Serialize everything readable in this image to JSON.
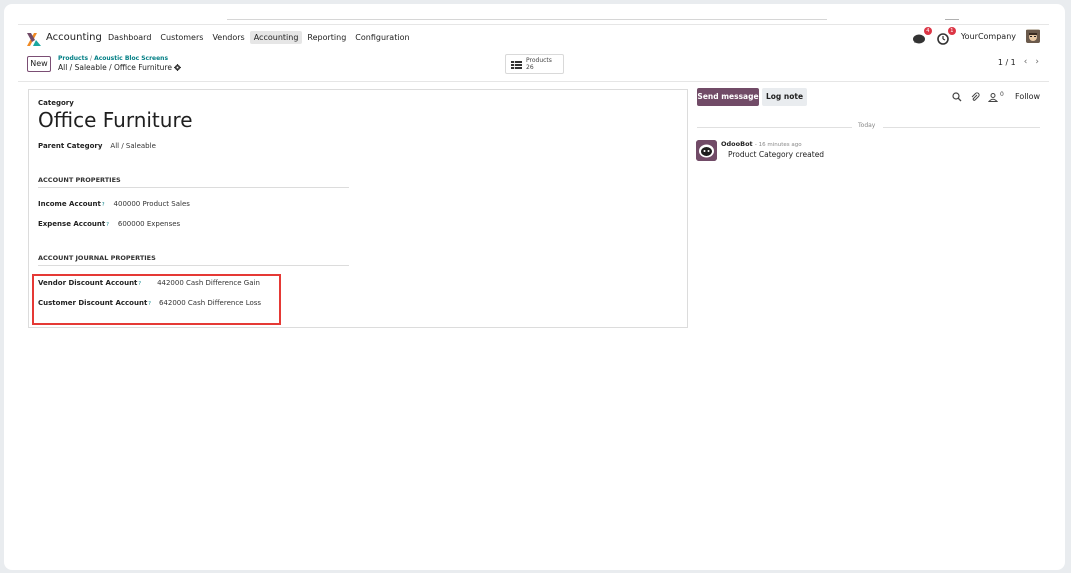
{
  "navbar": {
    "app_name": "Accounting",
    "menu": [
      "Dashboard",
      "Customers",
      "Vendors",
      "Accounting",
      "Reporting",
      "Configuration"
    ],
    "active_menu": "Accounting",
    "messages_badge": "4",
    "activities_badge": "1",
    "company": "YourCompany"
  },
  "control_panel": {
    "new_label": "New",
    "breadcrumb_parent": "Products",
    "breadcrumb_separator": "/",
    "breadcrumb_current": "Acoustic Bloc Screens",
    "record_path": "All / Saleable / Office Furniture",
    "smart_button_label": "Products",
    "smart_button_count": "26",
    "pager": "1 / 1"
  },
  "form": {
    "category_label": "Category",
    "category_name": "Office Furniture",
    "parent_category_label": "Parent Category",
    "parent_category_value": "All / Saleable",
    "section_account": "ACCOUNT PROPERTIES",
    "income_label": "Income Account",
    "income_value": "400000 Product Sales",
    "expense_label": "Expense Account",
    "expense_value": "600000 Expenses",
    "section_journal": "ACCOUNT JOURNAL PROPERTIES",
    "vendor_discount_label": "Vendor Discount Account",
    "vendor_discount_value": "442000 Cash Difference Gain",
    "customer_discount_label": "Customer Discount Account",
    "customer_discount_value": "642000 Cash Difference Loss",
    "help_mark": "?"
  },
  "chatter": {
    "send_message": "Send message",
    "log_note": "Log note",
    "followers_count": "0",
    "follow": "Follow",
    "date_separator": "Today",
    "messages": [
      {
        "author": "OdooBot",
        "time": "- 16 minutes ago",
        "body": "Product Category created"
      }
    ]
  },
  "colors": {
    "brand": "#714b67",
    "link": "#017e84",
    "highlight": "#e53935",
    "badge": "#dc3545"
  },
  "icons": [
    "accounting-app-icon",
    "chat-icon",
    "clock-icon",
    "gear-icon",
    "list-icon",
    "search-icon",
    "paperclip-icon",
    "user-icon",
    "bot-avatar-icon"
  ]
}
